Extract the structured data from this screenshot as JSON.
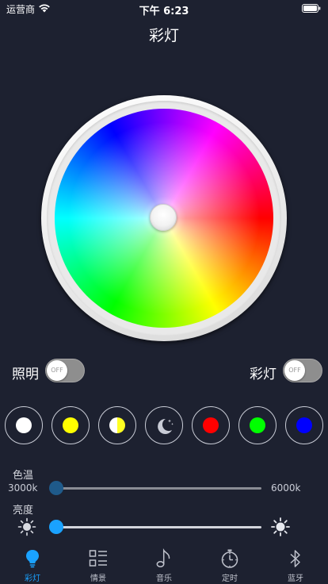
{
  "status_bar": {
    "carrier": "运营商",
    "time": "下午 6:23"
  },
  "page": {
    "title": "彩灯"
  },
  "toggles": {
    "lighting": {
      "label": "照明",
      "state": "OFF"
    },
    "color_light": {
      "label": "彩灯",
      "state": "OFF"
    }
  },
  "presets": [
    {
      "name": "white",
      "color": "#ffffff"
    },
    {
      "name": "yellow",
      "color": "#ffff00"
    },
    {
      "name": "half-white-yellow",
      "color": "#ffff22"
    },
    {
      "name": "night-moon",
      "color": "#c9ccd6"
    },
    {
      "name": "red",
      "color": "#ff0000"
    },
    {
      "name": "green",
      "color": "#00ff00"
    },
    {
      "name": "blue",
      "color": "#0000ff"
    }
  ],
  "color_temp": {
    "label": "色温",
    "min_label": "3000k",
    "max_label": "6000k",
    "value": 0.0
  },
  "brightness": {
    "label": "亮度",
    "value": 0.0
  },
  "colors": {
    "accent": "#1aa2ff",
    "background": "#1d2130"
  },
  "tabs": [
    {
      "label": "彩灯",
      "icon": "bulb-icon",
      "active": true
    },
    {
      "label": "情景",
      "icon": "list-icon",
      "active": false
    },
    {
      "label": "音乐",
      "icon": "music-note-icon",
      "active": false
    },
    {
      "label": "定时",
      "icon": "stopwatch-icon",
      "active": false
    },
    {
      "label": "蓝牙",
      "icon": "bluetooth-icon",
      "active": false
    }
  ]
}
